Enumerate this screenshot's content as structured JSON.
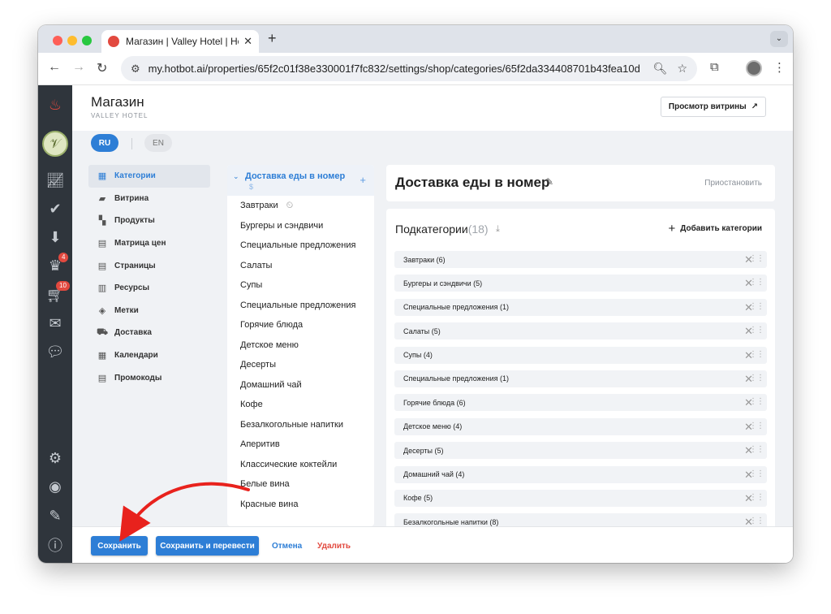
{
  "browser": {
    "tab_title": "Магазин | Valley Hotel | Hotb",
    "new_tab": "+",
    "url": "my.hotbot.ai/properties/65f2c01f38e330001f7fc832/settings/shop/categories/65f2da334408701b43fea10d"
  },
  "rail": {
    "badges": {
      "orders": "4",
      "cart": "10"
    }
  },
  "header": {
    "title": "Магазин",
    "subtitle": "VALLEY HOTEL",
    "preview_label": "Просмотр витрины"
  },
  "languages": {
    "ru": "RU",
    "en": "EN"
  },
  "settings_nav": [
    {
      "label": "Категории",
      "icon": "store-icon"
    },
    {
      "label": "Витрина",
      "icon": "cards-icon"
    },
    {
      "label": "Продукты",
      "icon": "grid-icon"
    },
    {
      "label": "Матрица цен",
      "icon": "table-icon"
    },
    {
      "label": "Страницы",
      "icon": "page-icon"
    },
    {
      "label": "Ресурсы",
      "icon": "resources-icon"
    },
    {
      "label": "Метки",
      "icon": "tag-icon"
    },
    {
      "label": "Доставка",
      "icon": "truck-icon"
    },
    {
      "label": "Календари",
      "icon": "calendar-icon"
    },
    {
      "label": "Промокоды",
      "icon": "promo-icon"
    }
  ],
  "category_panel": {
    "selected": "Доставка еды в номер",
    "selected_sub": "$",
    "items": [
      "Завтраки",
      "Бургеры и сэндвичи",
      "Специальные предложения",
      "Салаты",
      "Супы",
      "Специальные предложения",
      "Горячие блюда",
      "Детское меню",
      "Десерты",
      "Домашний чай",
      "Кофе",
      "Безалкогольные напитки",
      "Аперитив",
      "Классические коктейли",
      "Белые вина",
      "Красные вина"
    ]
  },
  "detail": {
    "title": "Доставка еды в номер",
    "pause_label": "Приостановить",
    "subcategories_label": "Подкатегории",
    "subcategories_count": "(18)",
    "add_label": "Добавить категории",
    "rows": [
      "Завтраки (6)",
      "Бургеры и сэндвичи (5)",
      "Специальные предложения (1)",
      "Салаты (5)",
      "Супы (4)",
      "Специальные предложения (1)",
      "Горячие блюда (6)",
      "Детское меню (4)",
      "Десерты (5)",
      "Домашний чай (4)",
      "Кофе (5)",
      "Безалкогольные напитки (8)"
    ]
  },
  "footer": {
    "save": "Сохранить",
    "save_translate": "Сохранить и перевести",
    "cancel": "Отмена",
    "delete": "Удалить"
  },
  "colors": {
    "accent": "#2d7ed6",
    "danger": "#e2493f",
    "rail": "#2f353c"
  }
}
